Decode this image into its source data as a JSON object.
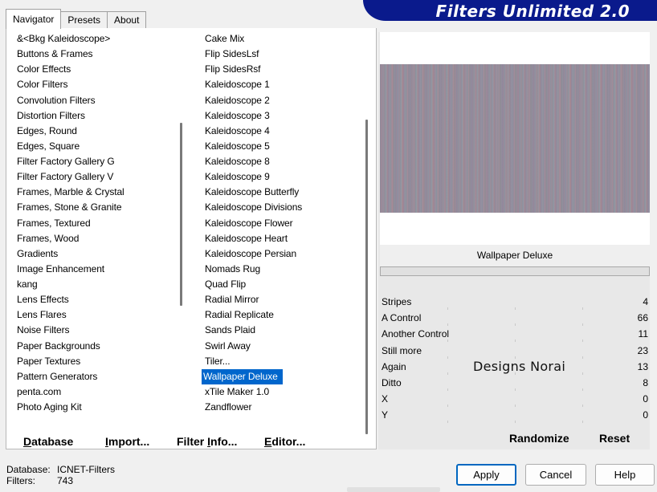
{
  "banner": {
    "title": "Filters Unlimited 2.0"
  },
  "tabs": [
    {
      "label": "Navigator",
      "active": true
    },
    {
      "label": "Presets",
      "active": false
    },
    {
      "label": "About",
      "active": false
    }
  ],
  "categories": [
    "&<Bkg Kaleidoscope>",
    "Buttons & Frames",
    "Color Effects",
    "Color Filters",
    "Convolution Filters",
    "Distortion Filters",
    "Edges, Round",
    "Edges, Square",
    "Filter Factory Gallery G",
    "Filter Factory Gallery V",
    "Frames, Marble & Crystal",
    "Frames, Stone & Granite",
    "Frames, Textured",
    "Frames, Wood",
    "Gradients",
    "Image Enhancement",
    "kang",
    "Lens Effects",
    "Lens Flares",
    "Noise Filters",
    "Paper Backgrounds",
    "Paper Textures",
    "Pattern Generators",
    "penta.com",
    "Photo Aging Kit"
  ],
  "filters": [
    "Cake Mix",
    "Flip SidesLsf",
    "Flip SidesRsf",
    "Kaleidoscope 1",
    "Kaleidoscope 2",
    "Kaleidoscope 3",
    "Kaleidoscope 4",
    "Kaleidoscope 5",
    "Kaleidoscope 8",
    "Kaleidoscope 9",
    "Kaleidoscope Butterfly",
    "Kaleidoscope Divisions",
    "Kaleidoscope Flower",
    "Kaleidoscope Heart",
    "Kaleidoscope Persian",
    "Nomads Rug",
    "Quad Flip",
    "Radial Mirror",
    "Radial Replicate",
    "Sands Plaid",
    "Swirl Away",
    "Tiler...",
    "Wallpaper Deluxe",
    "xTile Maker 1.0",
    "Zandflower"
  ],
  "selected_filter": "Wallpaper Deluxe",
  "bottom_buttons": {
    "database_u": "D",
    "database_rest": "atabase",
    "import_u": "I",
    "import_rest": "mport...",
    "filterinfo_pre": "Filter ",
    "filterinfo_u": "I",
    "filterinfo_rest": "nfo...",
    "editor_u": "E",
    "editor_rest": "ditor..."
  },
  "preview": {
    "filter_name": "Wallpaper Deluxe"
  },
  "controls": [
    {
      "label": "Stripes",
      "value": "4"
    },
    {
      "label": "A Control",
      "value": "66"
    },
    {
      "label": "Another Control",
      "value": "11"
    },
    {
      "label": "Still more",
      "value": "23"
    },
    {
      "label": "Again",
      "value": "13"
    },
    {
      "label": "Ditto",
      "value": "8"
    },
    {
      "label": "X",
      "value": "0"
    },
    {
      "label": "Y",
      "value": "0"
    }
  ],
  "watermark": "Designs Norai",
  "right_buttons": {
    "randomize": "Randomize",
    "reset": "Reset"
  },
  "footer": {
    "database_label": "Database:",
    "database_value": "ICNET-Filters",
    "filters_label": "Filters:",
    "filters_value": "743"
  },
  "dialog_buttons": {
    "apply": "Apply",
    "cancel": "Cancel",
    "help": "Help"
  }
}
